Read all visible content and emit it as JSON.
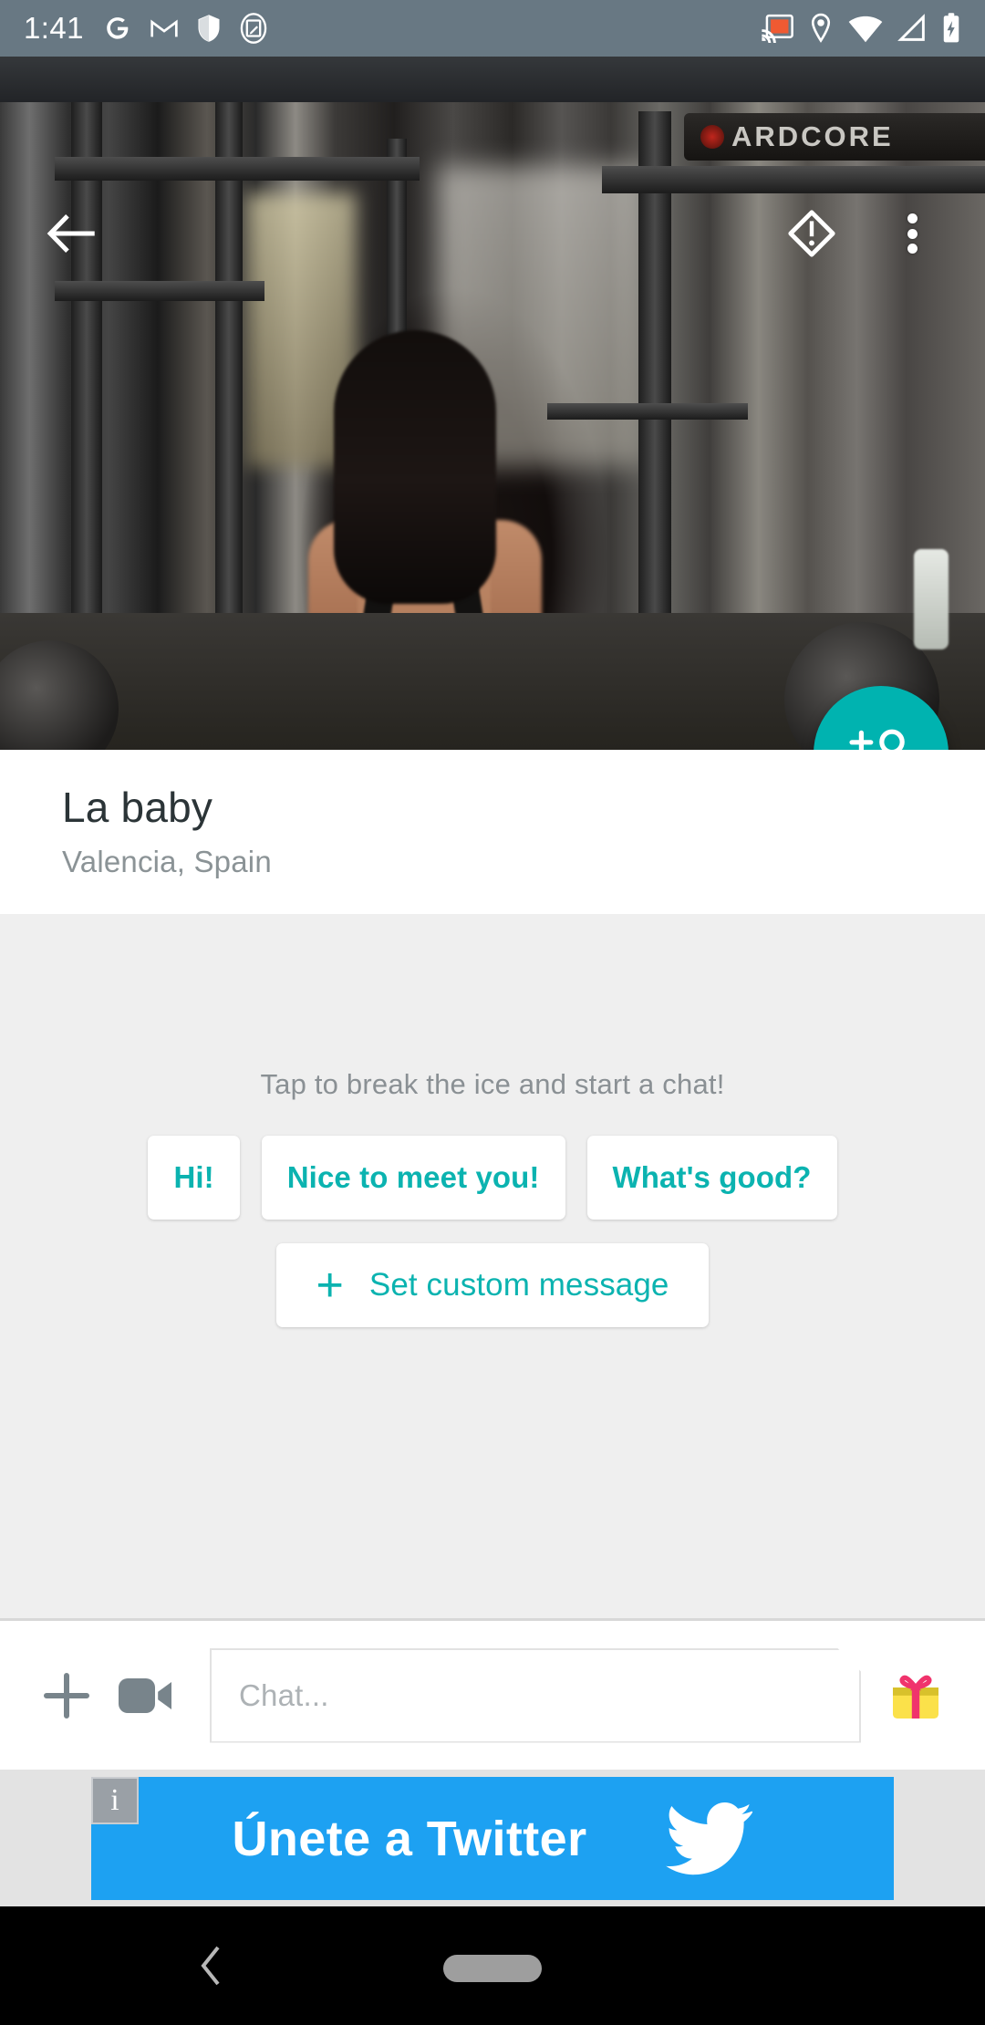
{
  "statusbar": {
    "time": "1:41",
    "left_icons": [
      "google-icon",
      "gmail-icon",
      "shield-icon",
      "screenshot-icon"
    ],
    "right_icons": [
      "cast-icon",
      "location-icon",
      "wifi-icon",
      "signal-icon",
      "battery-charging-icon"
    ],
    "background_color": "#687883"
  },
  "appbar": {
    "back_label": "back-arrow",
    "report_label": "report",
    "more_label": "more-options"
  },
  "photo": {
    "gym_sign_text": "ARDCORE",
    "alt": "Woman in gym in front of a squat rack"
  },
  "fab": {
    "label": "add-friend",
    "color": "#00b3b0"
  },
  "profile": {
    "name": "La baby",
    "location": "Valencia, Spain"
  },
  "chat": {
    "ice_hint": "Tap to break the ice and start a chat!",
    "quick_replies": [
      {
        "label": "Hi!"
      },
      {
        "label": "Nice to meet you!"
      },
      {
        "label": "What's good?"
      }
    ],
    "custom_message": {
      "plus": "+",
      "label": "Set custom message"
    },
    "accent_color": "#0bb3b0"
  },
  "inputbar": {
    "add_label": "add-attachment",
    "video_label": "video-message",
    "placeholder": "Chat...",
    "gift_label": "send-gift"
  },
  "ad": {
    "text": "Únete a Twitter",
    "info_glyph": "i",
    "brand": "twitter-bird-icon",
    "background_color": "#1da1f2"
  },
  "navbar": {
    "back_label": "system-back",
    "home_label": "home-pill"
  }
}
